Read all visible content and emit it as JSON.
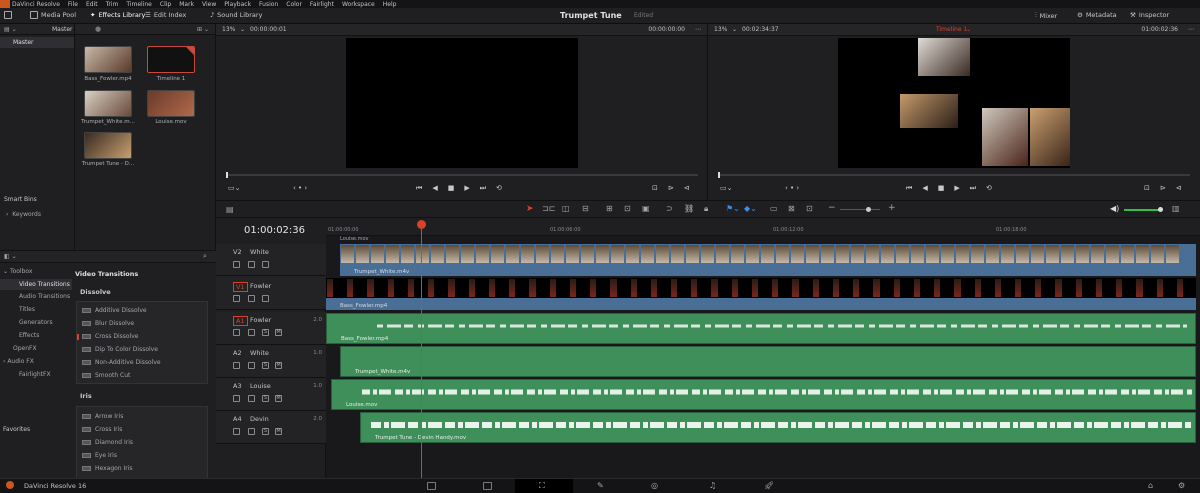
{
  "menu": [
    "DaVinci Resolve",
    "File",
    "Edit",
    "Trim",
    "Timeline",
    "Clip",
    "Mark",
    "View",
    "Playback",
    "Fusion",
    "Color",
    "Fairlight",
    "Workspace",
    "Help"
  ],
  "toolbar": {
    "media_pool": "Media Pool",
    "effects_library": "Effects Library",
    "edit_index": "Edit Index",
    "sound_library": "Sound Library",
    "project_title": "Trumpet Tune",
    "project_status": "Edited",
    "mixer": "Mixer",
    "metadata": "Metadata",
    "inspector": "Inspector"
  },
  "sidebar": {
    "master_header": "Master",
    "master_item": "Master",
    "smart_bins": "Smart Bins",
    "keywords": "Keywords"
  },
  "media_pool": {
    "clips": [
      {
        "name": "Bass_Fowler.mp4"
      },
      {
        "name": "Timeline 1"
      },
      {
        "name": "Trumpet_White.m..."
      },
      {
        "name": "Louise.mov"
      },
      {
        "name": "Trumpet Tune - D..."
      }
    ]
  },
  "source_viewer": {
    "zoom": "13%",
    "timecode": "00:00:00:01",
    "tc_right": "00:00:00:00"
  },
  "timeline_viewer": {
    "zoom": "13%",
    "timecode": "00:02:34:37",
    "timeline_name": "Timeline 1",
    "tc_right": "01:00:02:36"
  },
  "timeline": {
    "current_timecode": "01:00:02:36",
    "ruler_ticks": [
      "01:00:00:00",
      "01:00:06:00",
      "01:00:12:00",
      "01:00:18:00"
    ],
    "top_clip": "Louise.mov",
    "tracks": [
      {
        "id": "V2",
        "name": "White",
        "level": "",
        "clip": "Trumpet_White.m4v"
      },
      {
        "id": "V1",
        "name": "Fowler",
        "level": "",
        "clip": "Bass_Fowler.mp4"
      },
      {
        "id": "A1",
        "name": "Fowler",
        "level": "2.0",
        "clip": "Bass_Fowler.mp4"
      },
      {
        "id": "A2",
        "name": "White",
        "level": "1.0",
        "clip": "Trumpet_White.m4v"
      },
      {
        "id": "A3",
        "name": "Louise",
        "level": "1.0",
        "clip": "Louise.mov"
      },
      {
        "id": "A4",
        "name": "Devin",
        "level": "2.0",
        "clip": "Trumpet Tune - Devin Handy.mov"
      }
    ],
    "solo": "S",
    "mute": "M"
  },
  "effects": {
    "tree": [
      "Toolbox",
      "Video Transitions",
      "Audio Transitions",
      "Titles",
      "Generators",
      "Effects",
      "OpenFX",
      "Audio FX",
      "FairlightFX"
    ],
    "favorites": "Favorites",
    "section_title": "Video Transitions",
    "dissolve_title": "Dissolve",
    "dissolve": [
      "Additive Dissolve",
      "Blur Dissolve",
      "Cross Dissolve",
      "Dip To Color Dissolve",
      "Non-Additive Dissolve",
      "Smooth Cut"
    ],
    "iris_title": "Iris",
    "iris": [
      "Arrow Iris",
      "Cross Iris",
      "Diamond Iris",
      "Eye Iris",
      "Hexagon Iris"
    ]
  },
  "app_footer": "DaVinci Resolve 16",
  "colors": {
    "accent_red": "#d8412c",
    "video_clip": "#4a6f96",
    "audio_clip": "#3f8f5a",
    "brand_orange": "#c9571e"
  }
}
